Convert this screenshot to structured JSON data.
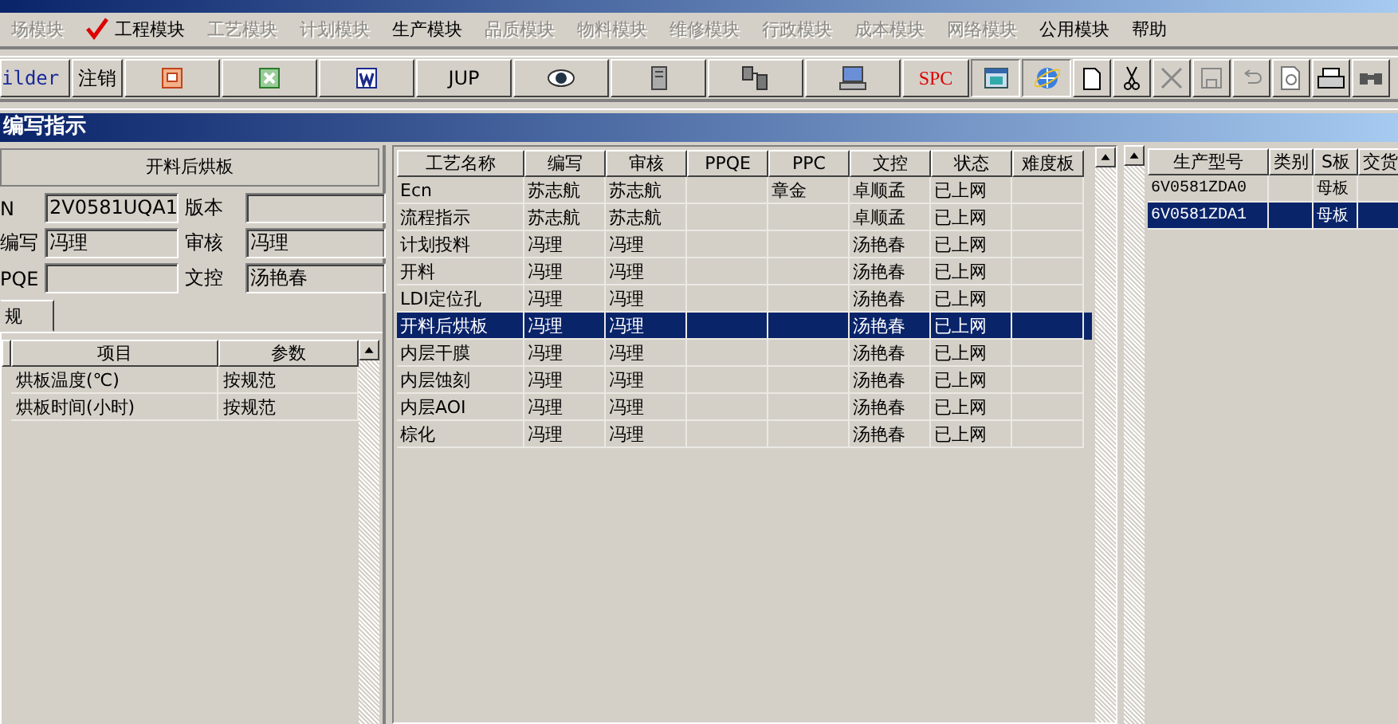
{
  "menu": [
    {
      "label": "场模块",
      "disabled": true,
      "checked": false
    },
    {
      "label": "工程模块",
      "disabled": false,
      "checked": true
    },
    {
      "label": "工艺模块",
      "disabled": true,
      "checked": false
    },
    {
      "label": "计划模块",
      "disabled": true,
      "checked": false
    },
    {
      "label": "生产模块",
      "disabled": false,
      "checked": false
    },
    {
      "label": "品质模块",
      "disabled": true,
      "checked": false
    },
    {
      "label": "物料模块",
      "disabled": true,
      "checked": false
    },
    {
      "label": "维修模块",
      "disabled": true,
      "checked": false
    },
    {
      "label": "行政模块",
      "disabled": true,
      "checked": false
    },
    {
      "label": "成本模块",
      "disabled": true,
      "checked": false
    },
    {
      "label": "网络模块",
      "disabled": true,
      "checked": false
    },
    {
      "label": "公用模块",
      "disabled": false,
      "checked": false
    },
    {
      "label": "帮助",
      "disabled": false,
      "checked": false
    }
  ],
  "toolbar": [
    {
      "kind": "link",
      "label": "ilder"
    },
    {
      "kind": "label",
      "label": "注销"
    },
    {
      "kind": "slides"
    },
    {
      "kind": "sheet"
    },
    {
      "kind": "doc"
    },
    {
      "kind": "label",
      "label": "JUP"
    },
    {
      "kind": "eye"
    },
    {
      "kind": "server"
    },
    {
      "kind": "network"
    },
    {
      "kind": "computer"
    },
    {
      "kind": "alert-label",
      "label": "SPC"
    },
    {
      "kind": "window"
    },
    {
      "kind": "globe"
    },
    {
      "kind": "new"
    },
    {
      "kind": "cut"
    },
    {
      "kind": "delete"
    },
    {
      "kind": "save"
    },
    {
      "kind": "undo"
    },
    {
      "kind": "preview"
    },
    {
      "kind": "print"
    },
    {
      "kind": "find"
    }
  ],
  "section_title": "编写指示",
  "detail": {
    "title": "开料后烘板",
    "fields": [
      {
        "label": "N",
        "value": "2V0581UQA1"
      },
      {
        "label": "版本"
      },
      {
        "label": "编写",
        "value": "冯理"
      },
      {
        "label": "审核",
        "value": "冯理"
      },
      {
        "label": "PQE"
      },
      {
        "label": "文控",
        "value": "汤艳春"
      }
    ],
    "tab": "规",
    "params": {
      "columns": [
        "项目",
        "参数"
      ],
      "rows": [
        [
          "烘板温度(℃)",
          "按规范"
        ],
        [
          "烘板时间(小时)",
          "按规范"
        ]
      ]
    }
  },
  "process_table": {
    "columns": [
      "工艺名称",
      "编写",
      "审核",
      "PPQE",
      "PPC",
      "文控",
      "状态",
      "难度板"
    ],
    "rows": [
      {
        "cells": [
          "Ecn",
          "苏志航",
          "苏志航",
          "",
          "章金",
          "卓顺孟",
          "已上网",
          ""
        ],
        "selected": false
      },
      {
        "cells": [
          "流程指示",
          "苏志航",
          "苏志航",
          "",
          "",
          "卓顺孟",
          "已上网",
          ""
        ],
        "selected": false
      },
      {
        "cells": [
          "计划投料",
          "冯理",
          "冯理",
          "",
          "",
          "汤艳春",
          "已上网",
          ""
        ],
        "selected": false
      },
      {
        "cells": [
          "开料",
          "冯理",
          "冯理",
          "",
          "",
          "汤艳春",
          "已上网",
          ""
        ],
        "selected": false
      },
      {
        "cells": [
          "LDI定位孔",
          "冯理",
          "冯理",
          "",
          "",
          "汤艳春",
          "已上网",
          ""
        ],
        "selected": false
      },
      {
        "cells": [
          "开料后烘板",
          "冯理",
          "冯理",
          "",
          "",
          "汤艳春",
          "已上网",
          ""
        ],
        "selected": true
      },
      {
        "cells": [
          "内层干膜",
          "冯理",
          "冯理",
          "",
          "",
          "汤艳春",
          "已上网",
          ""
        ],
        "selected": false
      },
      {
        "cells": [
          "内层蚀刻",
          "冯理",
          "冯理",
          "",
          "",
          "汤艳春",
          "已上网",
          ""
        ],
        "selected": false
      },
      {
        "cells": [
          "内层AOI",
          "冯理",
          "冯理",
          "",
          "",
          "汤艳春",
          "已上网",
          ""
        ],
        "selected": false
      },
      {
        "cells": [
          "棕化",
          "冯理",
          "冯理",
          "",
          "",
          "汤艳春",
          "已上网",
          ""
        ],
        "selected": false
      }
    ]
  },
  "model_table": {
    "columns": [
      "生产型号",
      "类别",
      "S板",
      "交货"
    ],
    "rows": [
      {
        "cells": [
          "6V0581ZDA0",
          "",
          "母板",
          ""
        ],
        "selected": false
      },
      {
        "cells": [
          "6V0581ZDA1",
          "",
          "母板",
          ""
        ],
        "selected": true
      }
    ]
  }
}
